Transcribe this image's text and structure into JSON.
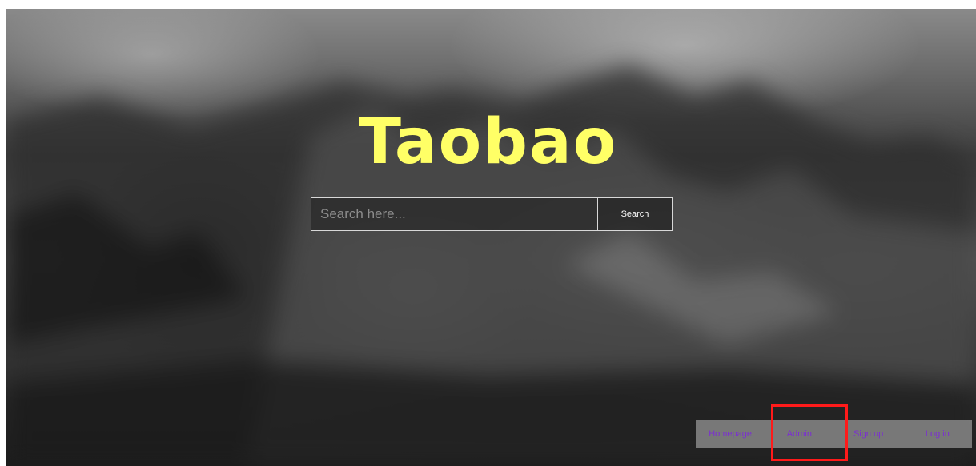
{
  "site": {
    "title": "Taobao"
  },
  "search": {
    "placeholder": "Search here...",
    "value": "",
    "button_label": "Search"
  },
  "nav": {
    "items": [
      {
        "label": "Homepage"
      },
      {
        "label": "Admin"
      },
      {
        "label": "Sign up"
      },
      {
        "label": "Log in"
      }
    ]
  },
  "colors": {
    "title": "#ffff66",
    "nav_link": "#7b2fd1",
    "highlight": "#ff1a1a"
  }
}
